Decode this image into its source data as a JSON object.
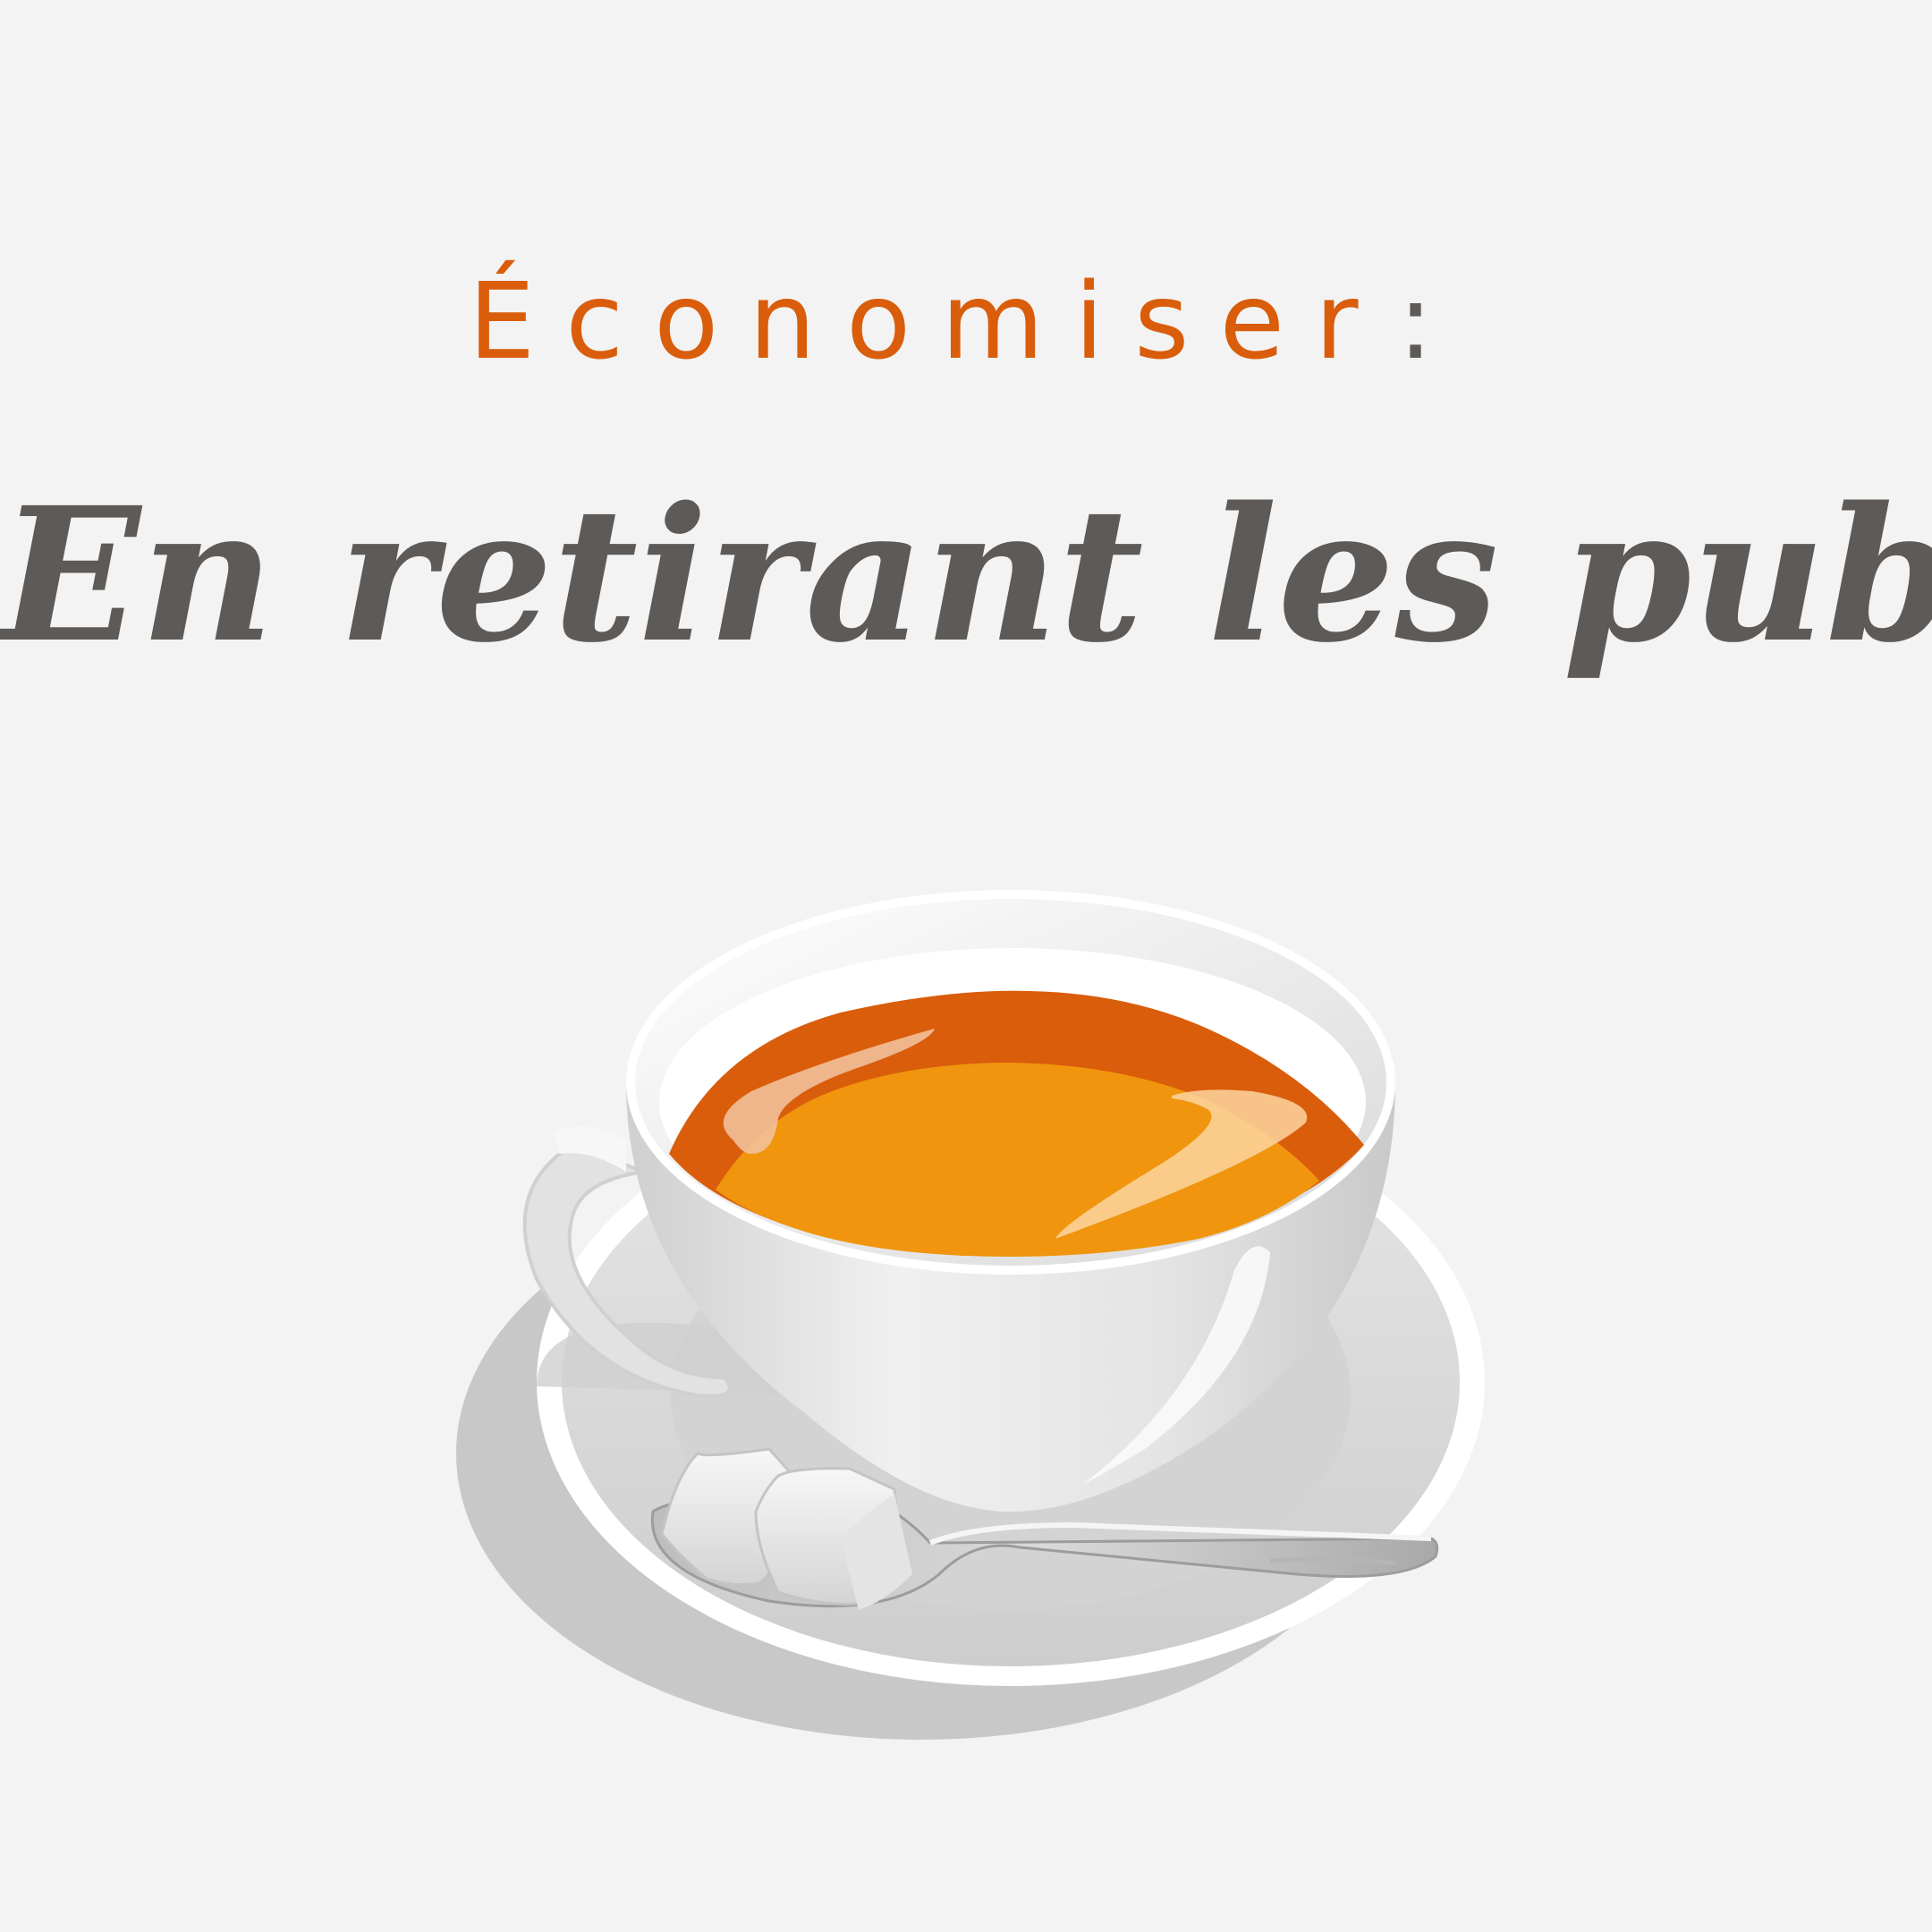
{
  "kicker": {
    "text": "Économiser",
    "colon": ":"
  },
  "headline": {
    "text": "En retirant les pubs"
  },
  "illustration": {
    "subject": "tea-cup-icon",
    "details": [
      "saucer-icon",
      "spoon-icon",
      "sugar-cube-icon"
    ]
  },
  "colors": {
    "background": "#f3f3f3",
    "accent_orange": "#d95d0b",
    "text_gray": "#5d5a57",
    "tea_light": "#f0950d"
  }
}
